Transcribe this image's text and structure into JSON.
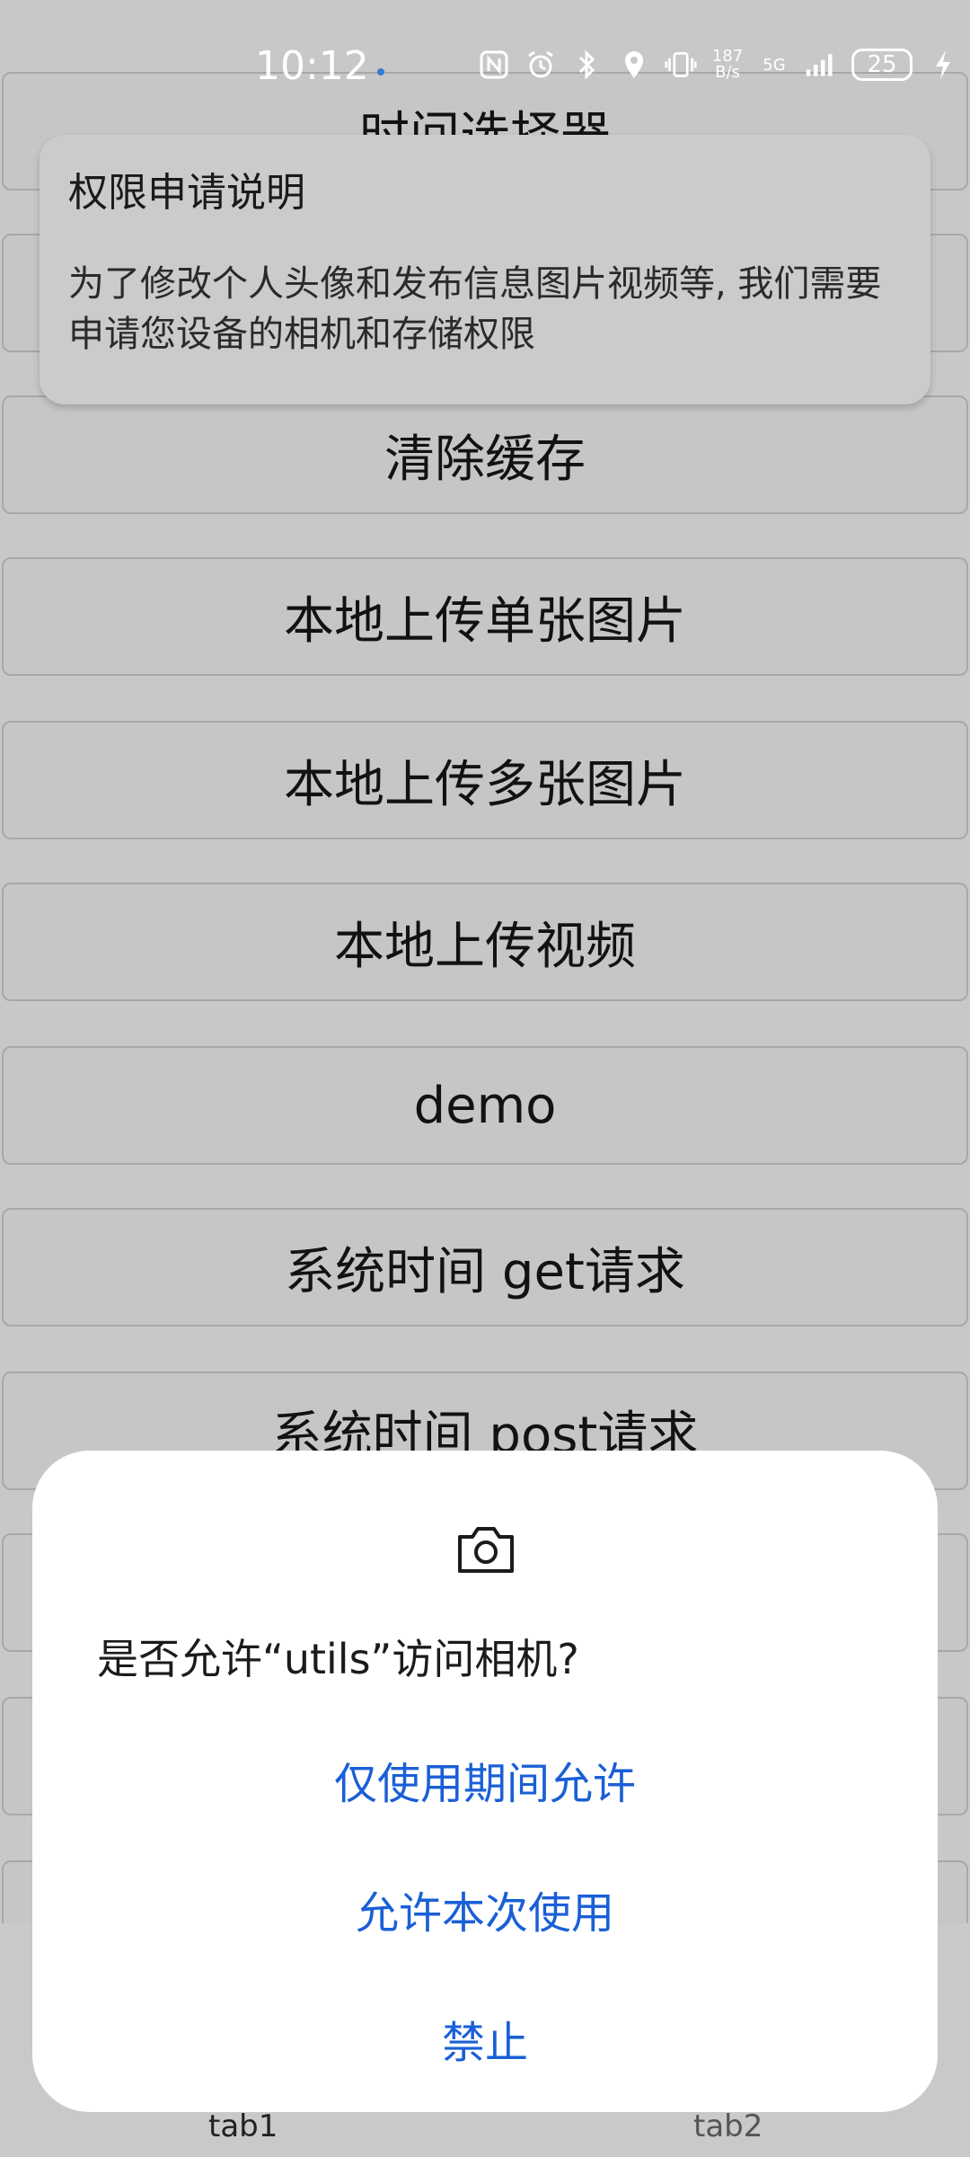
{
  "status_bar": {
    "time": "10:12",
    "net_speed_top": "187",
    "net_speed_bottom": "B/s",
    "signal_label": "5G",
    "battery": "25"
  },
  "list": {
    "buttons": [
      "时间选择器",
      "",
      "清除缓存",
      "本地上传单张图片",
      "本地上传多张图片",
      "本地上传视频",
      "demo",
      "系统时间 get请求",
      "系统时间 post请求"
    ]
  },
  "permission_card": {
    "title": "权限申请说明",
    "description": "为了修改个人头像和发布信息图片视频等, 我们需要申请您设备的相机和存储权限"
  },
  "dialog": {
    "icon": "camera-icon",
    "question": "是否允许“utils”访问相机?",
    "options": [
      "仅使用期间允许",
      "允许本次使用",
      "禁止"
    ],
    "accent_color": "#1a5fd6"
  },
  "tabs": [
    "tab1",
    "tab2"
  ]
}
